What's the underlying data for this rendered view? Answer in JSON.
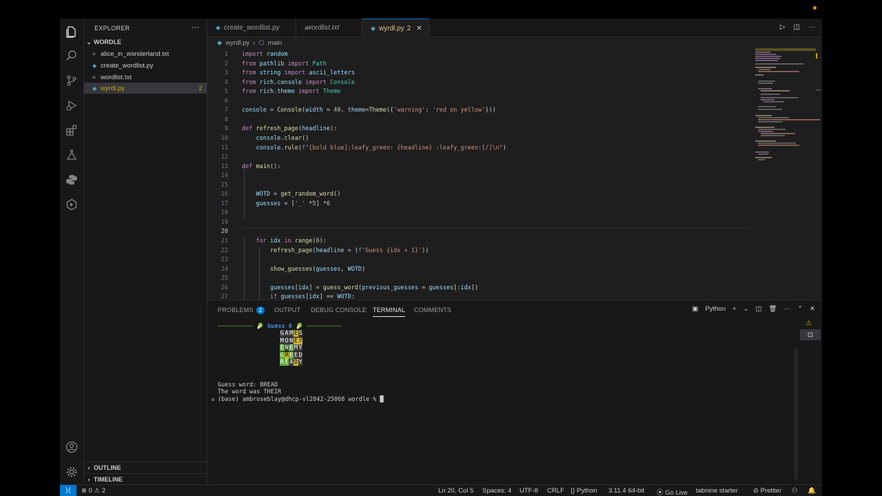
{
  "explorer": {
    "title": "EXPLORER",
    "more": "···",
    "folder": "WORDLE",
    "files": [
      {
        "name": "alice_in_wonderland.txt",
        "icon": "≡",
        "badge": ""
      },
      {
        "name": "create_wordlist.py",
        "icon": "◆",
        "badge": ""
      },
      {
        "name": "wordlist.txt",
        "icon": "≡",
        "badge": ""
      },
      {
        "name": "wyrdl.py",
        "icon": "◆",
        "badge": "2"
      }
    ],
    "outline": "OUTLINE",
    "timeline": "TIMELINE"
  },
  "tabs": [
    {
      "label": "create_wordlist.py",
      "icon": "◆"
    },
    {
      "label": "wordlist.txt",
      "icon": "≡"
    },
    {
      "label": "wyrdl.py",
      "badge": "2",
      "icon": "◆",
      "close": "✕"
    }
  ],
  "breadcrumb": {
    "file": "wyrdl.py",
    "sep": "›",
    "symbol": "main"
  },
  "code": {
    "line_numbers": [
      "1",
      "2",
      "3",
      "4",
      "5",
      "6",
      "7",
      "8",
      "9",
      "10",
      "11",
      "12",
      "13",
      "14",
      "15",
      "16",
      "17",
      "18",
      "19",
      "20",
      "21",
      "22",
      "23",
      "24",
      "25",
      "26",
      "27"
    ],
    "lines": [
      "import random",
      "from pathlib import Path",
      "from string import ascii_letters",
      "from rich.console import Console",
      "from rich.theme import Theme",
      "",
      "console = Console(width = 40, theme=Theme({'warning': 'red on yellow'}))",
      "",
      "def refresh_page(headline):",
      "    console.clear()",
      "    console.rule(f\"[bold blue]:leafy_green: {headline} :leafy_green:[/]\\n\")",
      "",
      "def main():",
      "",
      "",
      "    WOTD = get_random_word()",
      "    guesses = ['_' *5] *6",
      "",
      "",
      "",
      "    for idx in range(6):",
      "        refresh_page(headline = (f'Guess {idx + 1}'))",
      "",
      "        show_guesses(guesses, WOTD)",
      "",
      "        guesses[idx] = guess_word(previous_guesses = guesses[:idx])",
      "        if guesses[idx] == WOTD:"
    ]
  },
  "panel": {
    "tabs": [
      "PROBLEMS",
      "OUTPUT",
      "DEBUG CONSOLE",
      "TERMINAL",
      "COMMENTS"
    ],
    "problems_count": "2",
    "shell": "Python",
    "plus": "+",
    "chevron": "⌄",
    "more": "···"
  },
  "terminal": {
    "rule_left": "────────── 🥬",
    "headline": "Guess 6",
    "rule_right": "🥬 ──────────",
    "words": [
      "GAMES",
      "MONEY",
      "ENEMY",
      "GREED",
      "READY"
    ],
    "underline": "─────",
    "line1": "Guess word: BREAD",
    "line2": "The word was THEIR",
    "prompt": "(base) ambroseblay@dhcp-vl2042-25068 wordle % ",
    "cursor": "█"
  },
  "statusbar": {
    "remote": "⟩⟨",
    "errors": "0",
    "warnings": "2",
    "position": "Ln 20, Col 5",
    "spaces": "Spaces: 4",
    "encoding": "UTF-8",
    "eol": "CRLF",
    "language": "Python",
    "interpreter": "3.11.4 64-bit",
    "golive": "Go Live",
    "tabnine": "tabnine starter",
    "prettier": "Prettier"
  },
  "colors": {
    "accent": "#0078d4",
    "keyword": "#c586c0",
    "function": "#dcdcaa",
    "string": "#ce9178",
    "variable": "#9cdcfe",
    "class": "#4ec9b0",
    "green_tile": "#5fa83b",
    "yellow_tile": "#cdb42b"
  }
}
